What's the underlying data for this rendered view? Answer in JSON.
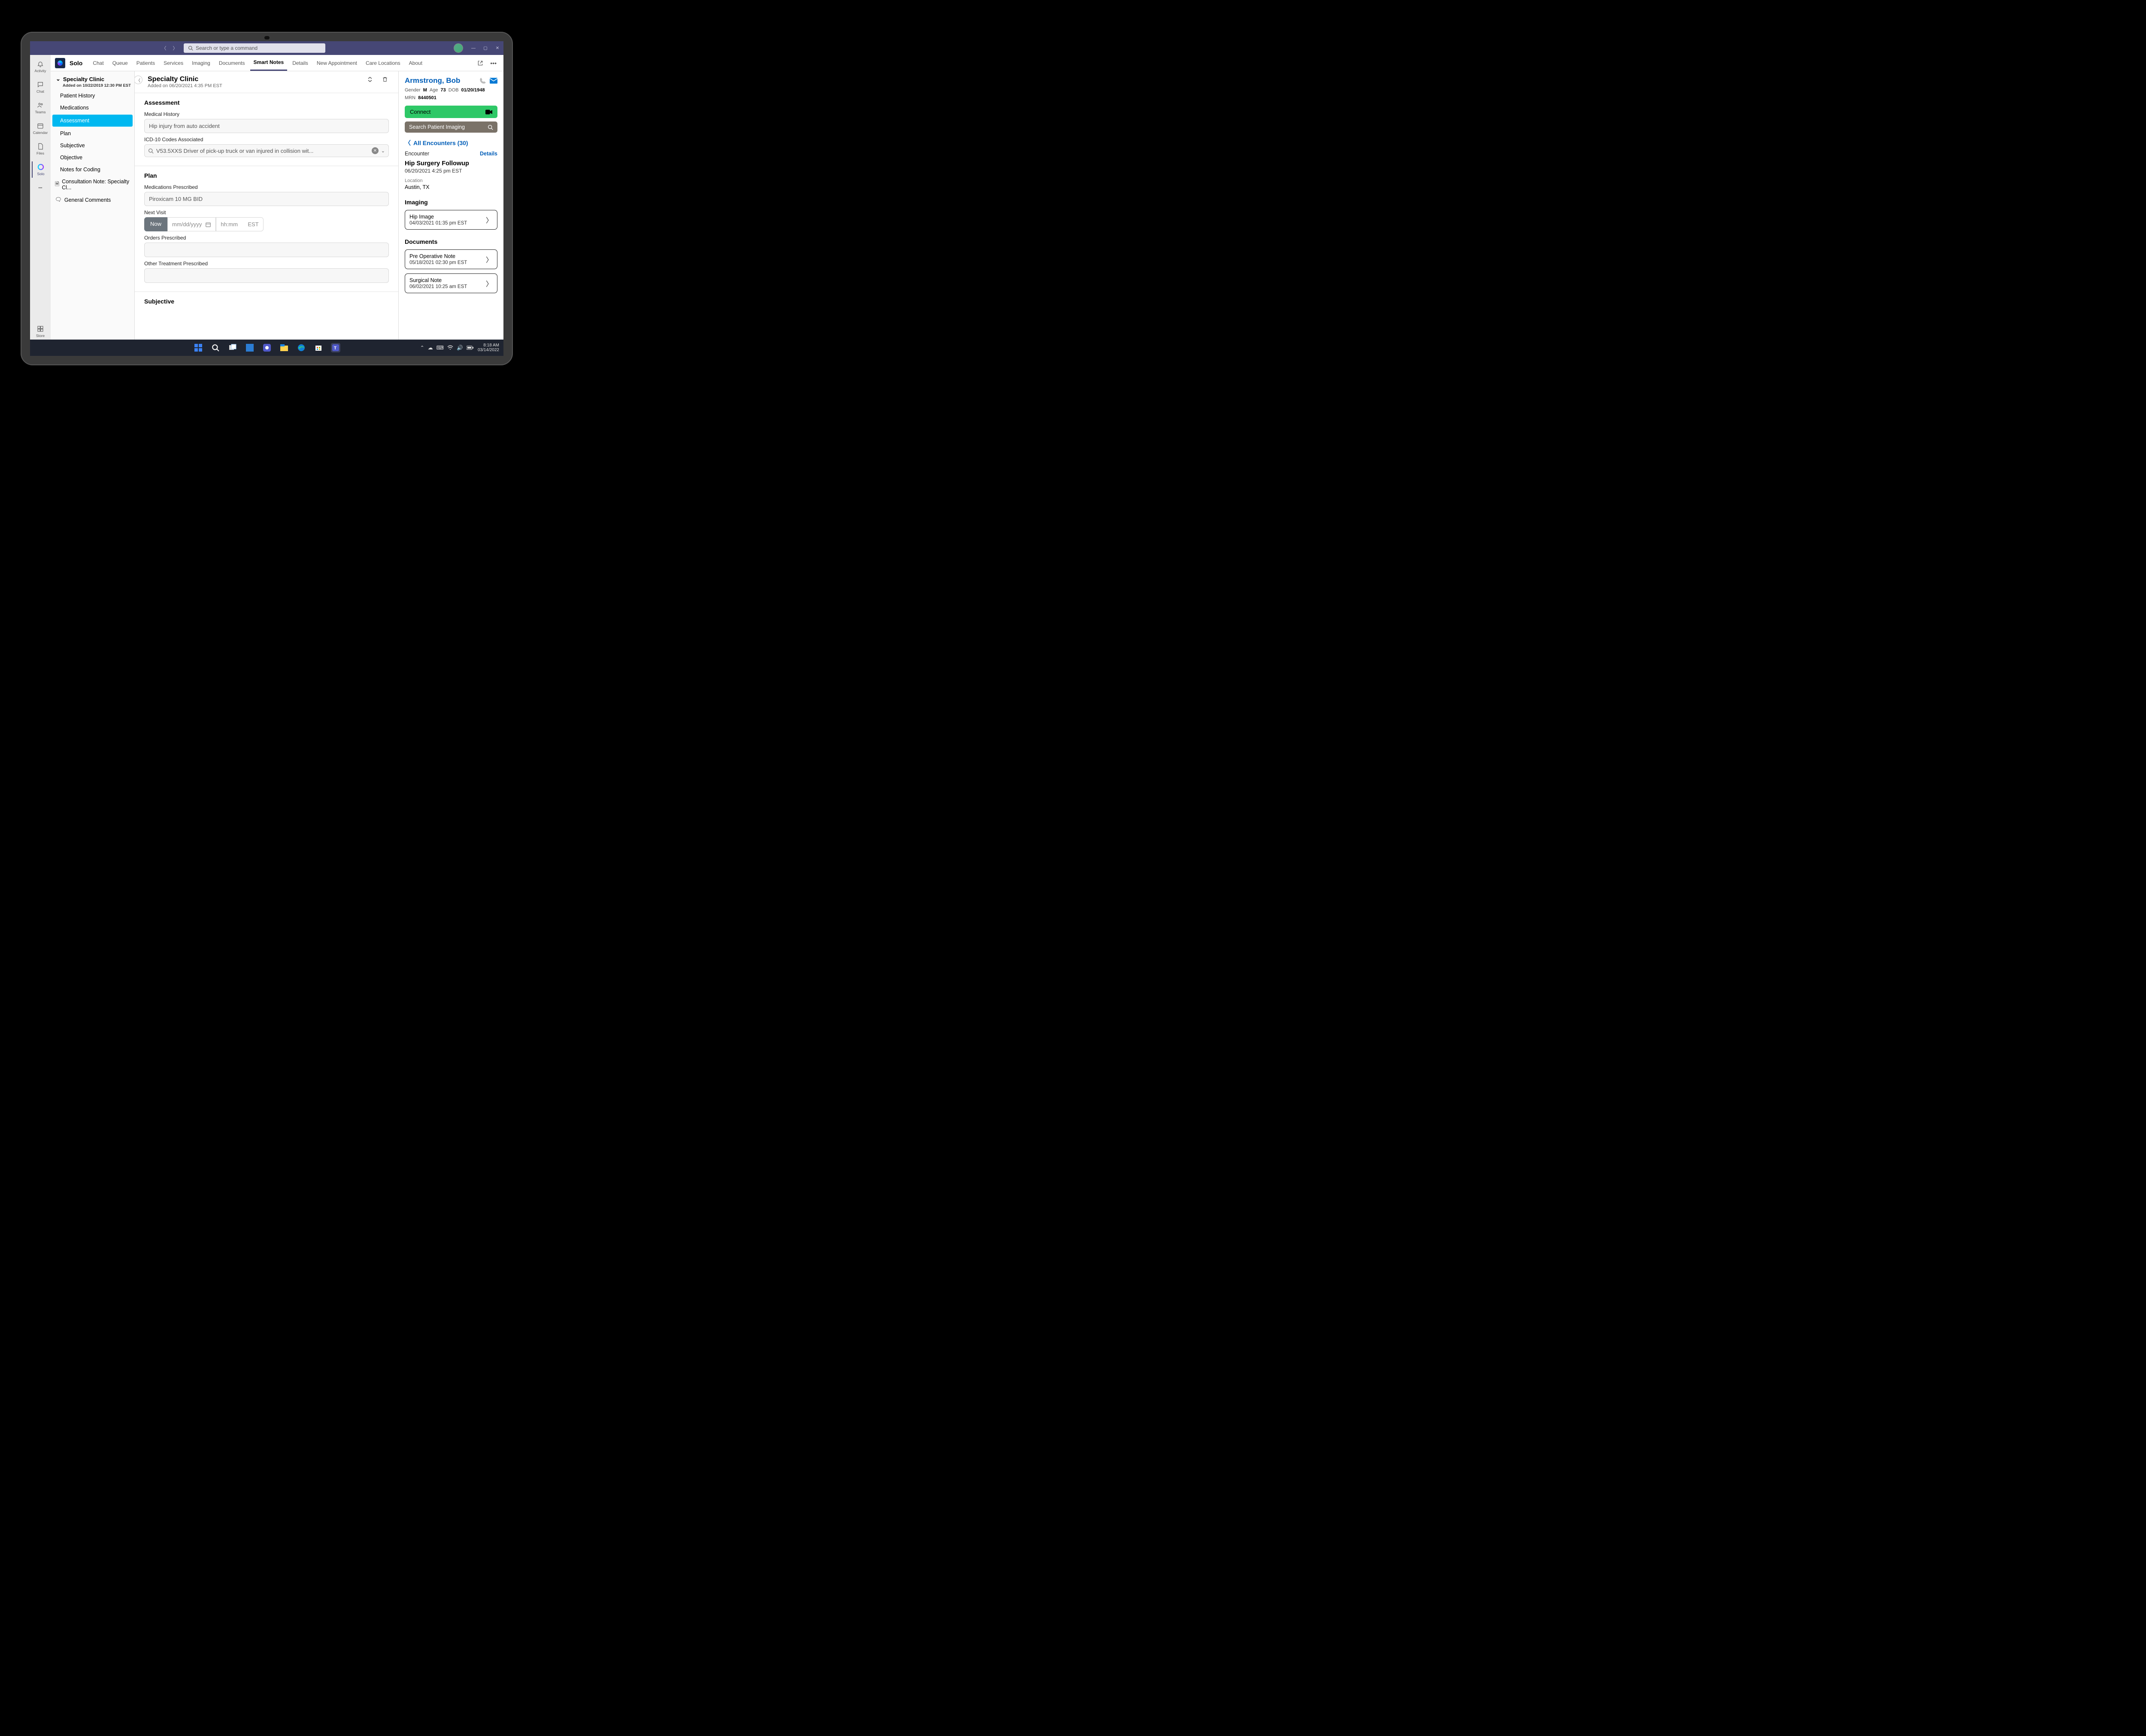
{
  "titlebar": {
    "search_placeholder": "Search or type a command"
  },
  "leftrail": {
    "items": [
      "Activity",
      "Chat",
      "Teams",
      "Calendar",
      "Files",
      "Solo",
      "Store"
    ],
    "active": 5
  },
  "tabs": {
    "app_name": "Solo",
    "items": [
      "Chat",
      "Queue",
      "Patients",
      "Services",
      "Imaging",
      "Documents",
      "Smart Notes",
      "Details",
      "New Appointment",
      "Care Locations",
      "About"
    ],
    "active": 6
  },
  "sidebar": {
    "group_title": "Specialty Clinic",
    "group_subtitle": "Added on 10/22/2019 12:30 PM EST",
    "items": [
      "Patient History",
      "Medications",
      "Assessment",
      "Plan",
      "Subjective",
      "Objective",
      "Notes for Coding"
    ],
    "active": 2,
    "docs": [
      {
        "icon": "📄",
        "label": "Consultation Note: Specialty Cl..."
      },
      {
        "icon": "💬",
        "label": "General Comments"
      }
    ]
  },
  "center": {
    "title": "Specialty Clinic",
    "subtitle": "Added on 06/20/2021 4:35 PM EST",
    "assessment": {
      "heading": "Assessment",
      "medical_history_label": "Medical History",
      "medical_history_value": "Hip injury from auto accident",
      "icd_label": "ICD-10 Codes Associated",
      "icd_value": "V53.5XXS Driver of pick-up truck or van injured in collision wit..."
    },
    "plan": {
      "heading": "Plan",
      "meds_label": "Medications Prescribed",
      "meds_value": "Piroxicam 10 MG BID",
      "next_visit_label": "Next Visit",
      "now_label": "Now",
      "date_placeholder": "mm/dd/yyyy",
      "time_placeholder": "hh:mm",
      "tz": "EST",
      "orders_label": "Orders Prescribed",
      "other_label": "Other Treatment Prescribed"
    },
    "subjective_heading": "Subjective"
  },
  "right": {
    "patient_name": "Armstrong, Bob",
    "demog": {
      "gender_label": "Gender",
      "gender": "M",
      "age_label": "Age",
      "age": "73",
      "dob_label": "DOB",
      "dob": "01/20/1948",
      "mrn_label": "MRN",
      "mrn": "8440501"
    },
    "connect_label": "Connect",
    "search_imaging_placeholder": "Search Patient Imaging",
    "all_encounters": "All Encounters (30)",
    "encounter_label": "Encounter",
    "details_label": "Details",
    "enc_title": "Hip Surgery Followup",
    "enc_date": "06/20/2021 4:25 pm EST",
    "location_label": "Location",
    "location_value": "Austin, TX",
    "imaging_heading": "Imaging",
    "imaging_card": {
      "title": "Hip Image",
      "date": "04/03/2021 01:35 pm EST"
    },
    "documents_heading": "Documents",
    "doc_cards": [
      {
        "title": "Pre Operative Note",
        "date": "05/18/2021 02:30 pm EST"
      },
      {
        "title": "Surgical Note",
        "date": "06/02/2021 10:25 am EST"
      }
    ]
  },
  "taskbar": {
    "time": "8:18 AM",
    "date": "03/14/2022"
  }
}
